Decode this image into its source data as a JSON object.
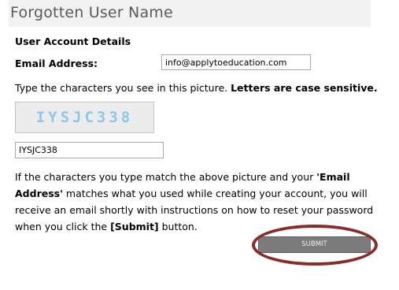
{
  "page": {
    "title": "Forgotten User Name"
  },
  "form": {
    "section_title": "User Account Details",
    "email_label": "Email Address:",
    "email_value": "info@applytoeducation.com",
    "instruction_prefix": "Type the characters you see in this picture. ",
    "instruction_bold": "Letters are case sensitive.",
    "captcha_image_text": "IYSJC338",
    "captcha_value": "IYSJC338",
    "help": {
      "line1_prefix": "If the characters you type match the above picture and your ",
      "line1_bold": "'Email",
      "line2_bold": "Address'",
      "line2_rest": " matches what you used while creating your account, you will",
      "line3": "receive an email shortly with instructions on how to reset your password",
      "line4_prefix": "when you click the ",
      "line4_bold": "[Submit]",
      "line4_suffix": " button."
    },
    "submit_label": "SUBMIT"
  },
  "colors": {
    "panel_background": "#f2f2f2",
    "captcha_text": "#8cc8ea",
    "submit_background": "#7b7b7b",
    "highlight_ellipse": "#8b2a2a"
  }
}
